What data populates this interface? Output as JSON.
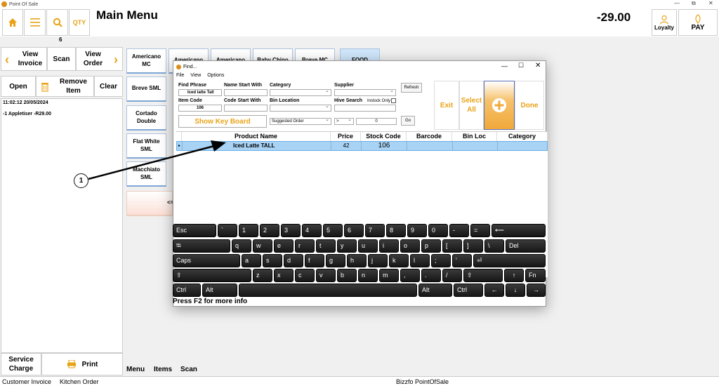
{
  "window": {
    "title": "Point Of Sale",
    "controls": [
      "—",
      "⧉",
      "✕"
    ]
  },
  "toolbar": {
    "home_icon": "home-icon",
    "menu_icon": "hamburger-icon",
    "search_icon": "search-icon",
    "qty_label": "QTY",
    "qty_count": "6",
    "title": "Main Menu",
    "total": "-29.00",
    "loyalty_label": "Loyalty",
    "pay_label": "PAY"
  },
  "left": {
    "view_invoice": "View Invoice",
    "scan": "Scan",
    "view_order": "View Order",
    "open": "Open",
    "remove_item": "Remove Item",
    "clear": "Clear",
    "timestamp": "11:02:12   20/05/2024",
    "line_item": "-1  Appletiser  -R29.00",
    "service_charge": "Service Charge",
    "print": "Print"
  },
  "menu_items": [
    "Americano MC",
    "Americano",
    "Americano",
    "Baby Chino",
    "Breve MC",
    "FOOD",
    "Breve SML",
    "Cortado Double",
    "Flat White SML",
    "Macchiato SML",
    "<="
  ],
  "tabs": {
    "menu": "Menu",
    "items": "Items",
    "scan": "Scan"
  },
  "status": {
    "customer_invoice": "Customer Invoice",
    "kitchen_order": "Kitchen Order",
    "app_name": "Bizzfo PointOfSale"
  },
  "find": {
    "title": "Find...",
    "menu": [
      "File",
      "View",
      "Options"
    ],
    "find_phrase_label": "Find Phrase",
    "find_phrase_value": "Iced latte Tall",
    "item_code_label": "Item Code",
    "item_code_value": "106",
    "name_start_label": "Name Start With",
    "code_start_label": "Code Start With",
    "category_label": "Category",
    "bin_location_label": "Bin Location",
    "supplier_label": "Supplier",
    "hive_search_label": "Hive Search",
    "instock_only_label": "Instock Only",
    "refresh": "Refresh",
    "show_keyboard": "Show Key Board",
    "suggested_order": "Suggested Order",
    "operator": ">",
    "threshold": "0",
    "go": "Go",
    "exit": "Exit",
    "select_all": "Select All",
    "add_icon": "plus-icon",
    "done": "Done",
    "columns": [
      "Product Name",
      "Price",
      "Stock Code",
      "Barcode",
      "Bin Loc",
      "Category"
    ],
    "rows": [
      {
        "product": "Iced Latte TALL",
        "price": "42",
        "stock_code": "106",
        "barcode": "",
        "bin_loc": "",
        "category": ""
      }
    ],
    "hint": "Press F2 for more info"
  },
  "keyboard": {
    "row1": [
      "Esc",
      "`",
      "1",
      "2",
      "3",
      "4",
      "5",
      "6",
      "7",
      "8",
      "9",
      "0",
      "-",
      "=",
      "⟵"
    ],
    "row2": [
      "⭾",
      "q",
      "w",
      "e",
      "r",
      "t",
      "y",
      "u",
      "i",
      "o",
      "p",
      "[",
      "]",
      "\\",
      "Del"
    ],
    "row3": [
      "Caps",
      "a",
      "s",
      "d",
      "f",
      "g",
      "h",
      "j",
      "k",
      "l",
      ";",
      "'",
      "⏎"
    ],
    "row4": [
      "⇧",
      "z",
      "x",
      "c",
      "v",
      "b",
      "n",
      "m",
      ",",
      ".",
      "/",
      "⇧",
      "↑",
      "Fn"
    ],
    "row5": [
      "Ctrl",
      "Alt",
      "",
      "Alt",
      "Ctrl",
      "←",
      "↓",
      "→"
    ]
  },
  "annotation": {
    "label": "1"
  }
}
